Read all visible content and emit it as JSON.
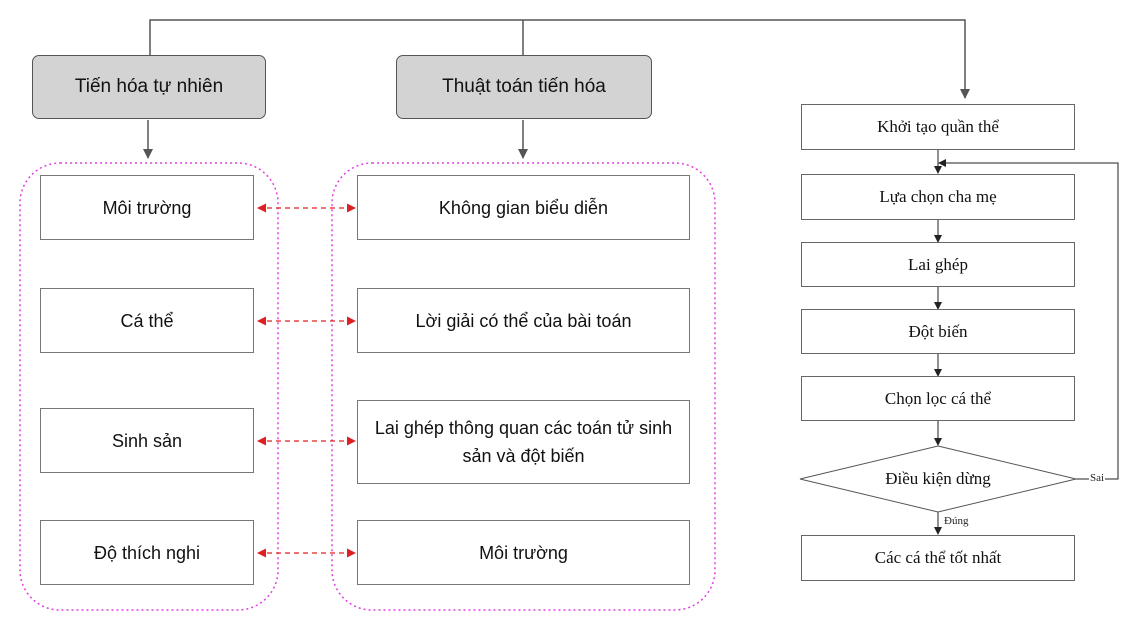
{
  "headers": {
    "natural": "Tiến hóa tự nhiên",
    "algorithm": "Thuật toán tiến hóa"
  },
  "natural_items": [
    "Môi trường",
    "Cá thể",
    "Sinh sản",
    "Độ thích nghi"
  ],
  "algorithm_items": [
    "Không gian biểu diễn",
    "Lời giải có thể của bài toán",
    "Lai ghép thông quan các toán tử sinh sản và đột biến",
    "Môi trường"
  ],
  "flowchart": {
    "steps": [
      "Khởi tạo quần thể",
      "Lựa chọn cha mẹ",
      "Lai ghép",
      "Đột biến",
      "Chọn lọc cá thể"
    ],
    "decision": "Điều kiện dừng",
    "no_label": "Sai",
    "yes_label": "Đúng",
    "result": "Các cá thể tốt nhất"
  },
  "colors": {
    "header_fill": "#d3d3d3",
    "group_border": "#e040e0",
    "mapping_arrow": "#e02020",
    "connector": "#555555"
  }
}
